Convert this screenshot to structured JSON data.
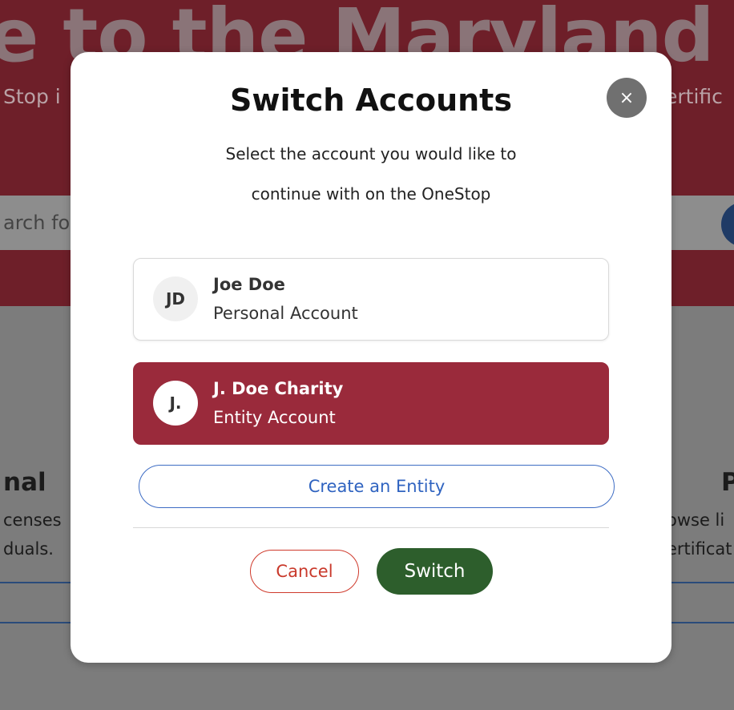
{
  "background": {
    "hero_title": "e to the Maryland OneSto",
    "hero_subtitle_left": "Stop i",
    "hero_subtitle_right": "ertific",
    "search_placeholder": "arch fo",
    "left_card": {
      "title": "nal",
      "line1": "censes",
      "line2": "duals."
    },
    "right_card": {
      "title": "P",
      "line1": "owse li",
      "line2": "ertificat"
    }
  },
  "modal": {
    "title": "Switch Accounts",
    "subtitle": "Select the account you would like to continue with on the OneStop",
    "close_label": "×",
    "accounts": [
      {
        "initials": "JD",
        "name": "Joe Doe",
        "type": "Personal Account",
        "selected": false
      },
      {
        "initials": "J.",
        "name": "J. Doe Charity",
        "type": "Entity Account",
        "selected": true
      }
    ],
    "create_label": "Create an Entity",
    "cancel_label": "Cancel",
    "switch_label": "Switch"
  },
  "colors": {
    "selected_account": "#9a2a3b",
    "switch_button": "#2d5e2c",
    "create_button_border": "#3d6cc4",
    "cancel_button": "#cf3a2c"
  }
}
